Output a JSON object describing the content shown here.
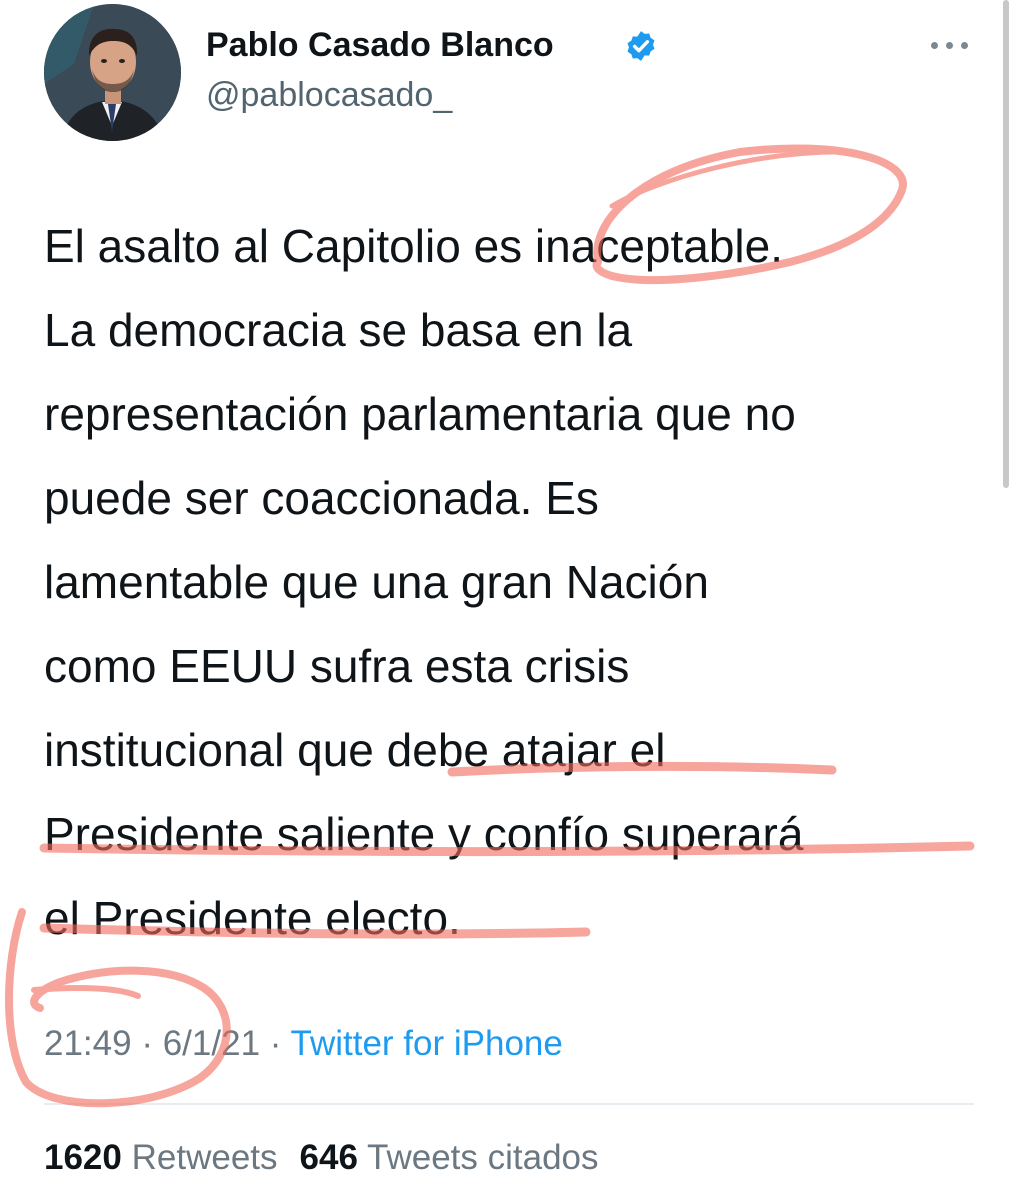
{
  "author": {
    "name": "Pablo Casado Blanco",
    "handle": "@pablocasado_",
    "avatar_icon": "profile-photo",
    "verified_icon": "verified-badge-icon",
    "verified_color": "#1d9bf0"
  },
  "tweet": {
    "lines": [
      "El asalto al Capitolio es inaceptable.",
      "La democracia se basa en la",
      "representación parlamentaria que no",
      "puede ser coaccionada. Es",
      "lamentable que una gran Nación",
      "como EEUU sufra esta crisis",
      "institucional que debe atajar el",
      "Presidente saliente y confío superará",
      "el Presidente electo."
    ],
    "time": "21:49",
    "date": "6/1/21",
    "separator": "·",
    "source": "Twitter for iPhone"
  },
  "stats": {
    "retweets_count": "1620",
    "retweets_label": "Retweets",
    "quotes_count": "646",
    "quotes_label": "Tweets citados"
  },
  "colors": {
    "link": "#1d9bf0",
    "secondary_text": "#6b7781",
    "annotation": "#f26a5c"
  }
}
